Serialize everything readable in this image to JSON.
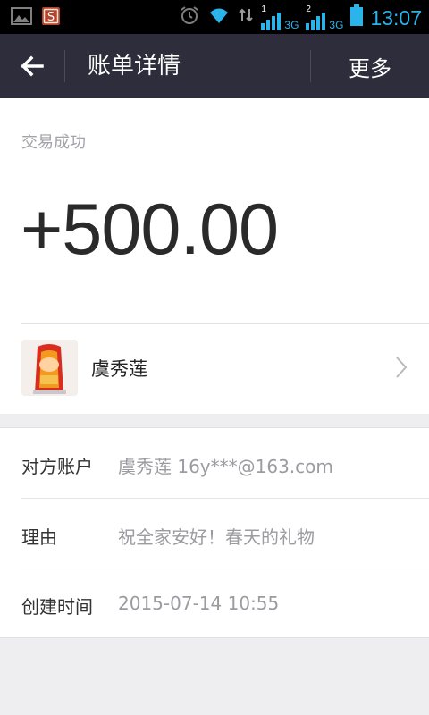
{
  "status_bar": {
    "time": "13:07",
    "sim1_label": "1",
    "sim2_label": "2",
    "network1": "3G",
    "network2": "3G",
    "app_icon_text": "S",
    "colors": {
      "background": "#000000",
      "accent": "#2bb4ea"
    },
    "icons": [
      "image-icon",
      "app-notification-icon",
      "alarm-icon",
      "wifi-icon",
      "data-transfer-icon",
      "signal-icon",
      "signal-icon",
      "battery-icon"
    ]
  },
  "header": {
    "back_icon": "arrow-left-icon",
    "title": "账单详情",
    "more_label": "更多",
    "background": "#2d2d3b"
  },
  "summary": {
    "status_text": "交易成功",
    "amount": "+500.00",
    "counterparty_name": "虞秀莲",
    "avatar_icon": "avatar-image",
    "chevron_icon": "chevron-right-icon"
  },
  "details": {
    "rows": [
      {
        "label": "对方账户",
        "value": "虞秀莲 16y***@163.com"
      },
      {
        "label": "理由",
        "value": "祝全家安好！春天的礼物"
      },
      {
        "label": "创建时间",
        "value": "2015-07-14 10:55"
      }
    ]
  }
}
